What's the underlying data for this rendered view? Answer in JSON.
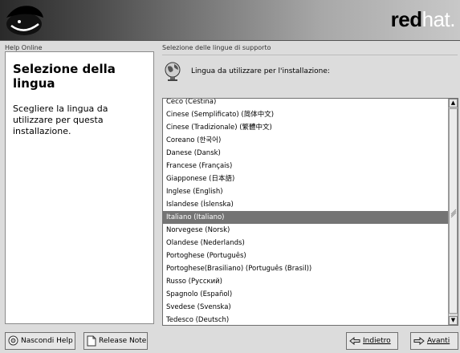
{
  "header": {
    "brand_bold": "red",
    "brand_thin": "hat."
  },
  "help": {
    "frame_title": "Help Online",
    "title": "Selezione della lingua",
    "text": "Scegliere la lingua da utilizzare per questa installazione."
  },
  "main": {
    "frame_title": "Selezione delle lingue di supporto",
    "prompt": "Lingua da utilizzare per l'installazione:",
    "languages": [
      "Ceco (Čeština)",
      "Cinese (Semplificato) (简体中文)",
      "Cinese (Tradizionale) (繁體中文)",
      "Coreano (한국어)",
      "Danese (Dansk)",
      "Francese (Français)",
      "Giapponese (日本語)",
      "Inglese (English)",
      "Islandese (Íslenska)",
      "Italiano (Italiano)",
      "Norvegese (Norsk)",
      "Olandese (Nederlands)",
      "Portoghese (Português)",
      "Portoghese(Brasiliano) (Português (Brasil))",
      "Russo (Русский)",
      "Spagnolo (Español)",
      "Svedese (Svenska)",
      "Tedesco (Deutsch)"
    ],
    "selected_index": 9
  },
  "buttons": {
    "hide_help": "Nascondi Help",
    "release_notes": "Release Note",
    "back": "Indietro",
    "next": "Avanti"
  }
}
